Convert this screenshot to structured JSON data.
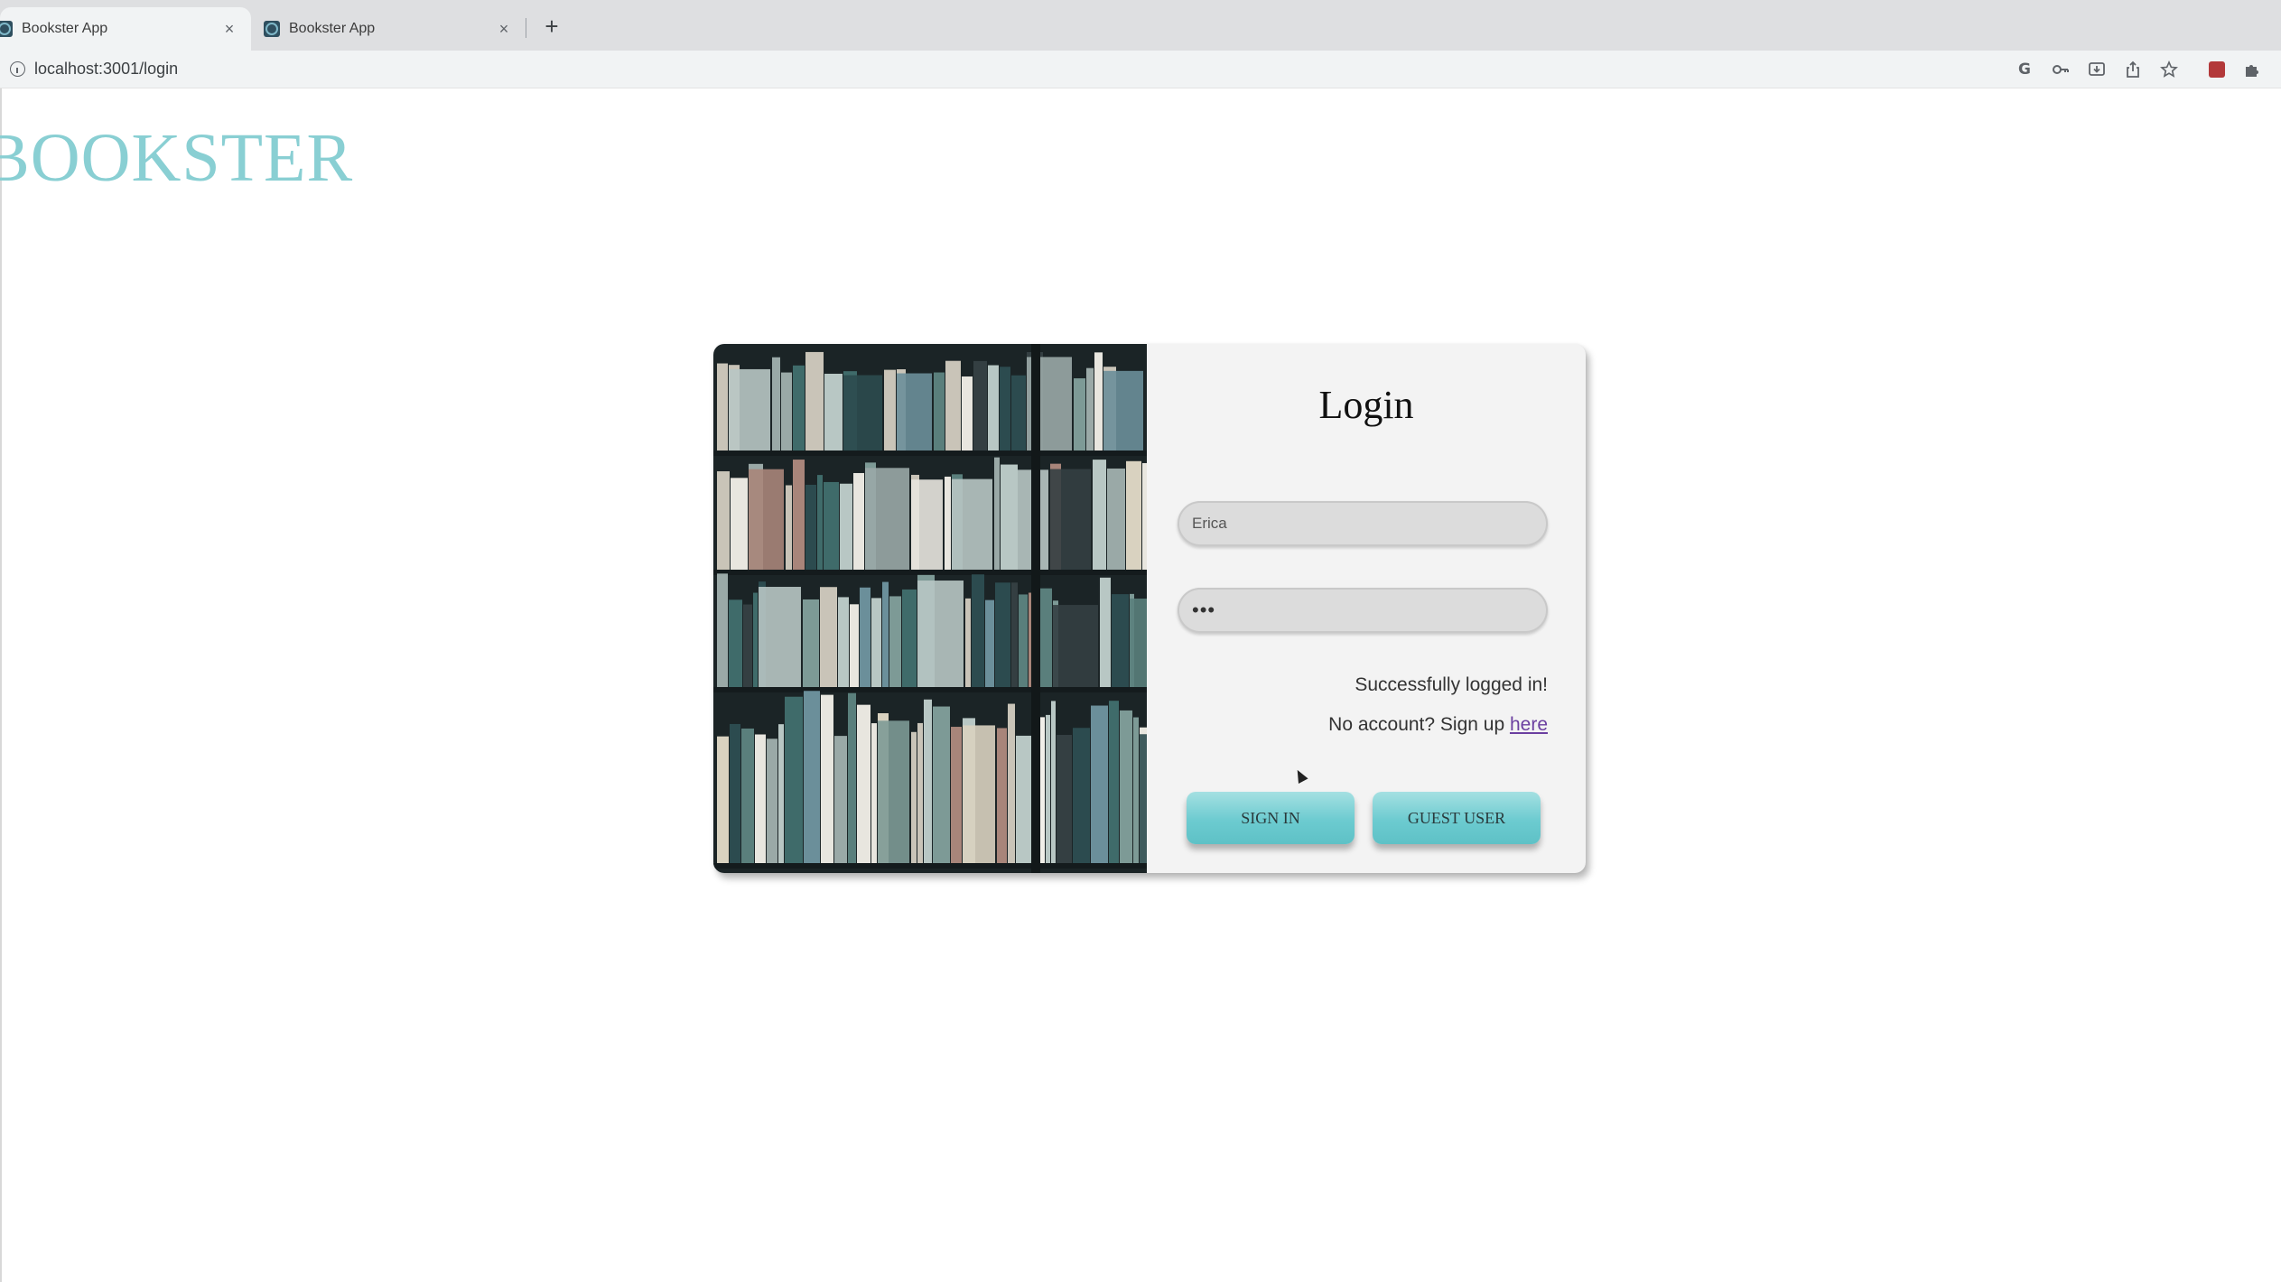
{
  "browser": {
    "tabs": [
      {
        "title": "Bookster App",
        "active": true
      },
      {
        "title": "Bookster App",
        "active": false
      }
    ],
    "close_glyph": "×",
    "new_tab_glyph": "+",
    "url": "localhost:3001/login",
    "toolbar_icons": [
      "google-icon",
      "key-icon",
      "install-icon",
      "share-icon",
      "star-icon",
      "extension-red-icon",
      "puzzle-icon"
    ]
  },
  "page": {
    "logo": "BOOKSTER",
    "login": {
      "title": "Login",
      "username_value": "Erica",
      "password_value": "•••",
      "status_message": "Successfully logged in!",
      "signup_prompt": "No account? Sign up",
      "signup_link": "here",
      "sign_in_label": "SIGN IN",
      "guest_label": "GUEST USER"
    }
  },
  "colors": {
    "accent": "#6ccbd0",
    "logo": "#89cfd3",
    "link": "#6b3fa0"
  }
}
